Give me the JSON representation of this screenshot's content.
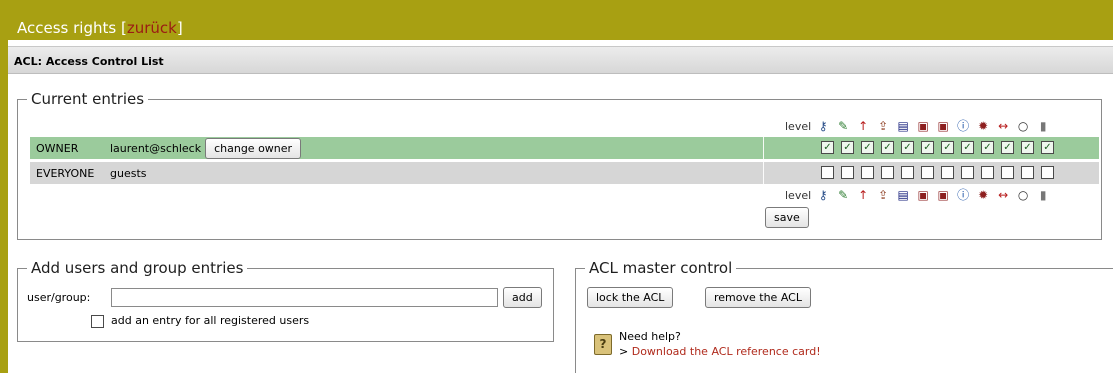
{
  "titlebar": {
    "title": "Access rights",
    "bracket_open": "[",
    "back_link": "zurück",
    "bracket_close": "]"
  },
  "acl_header": "ACL: Access Control List",
  "current_entries": {
    "legend": "Current entries",
    "level_label": "level",
    "permission_icons": [
      "key-icon",
      "pencil-icon",
      "arrow-up-icon",
      "upload-icon",
      "folder-icon",
      "folder-in-icon",
      "folder-out-icon",
      "info-icon",
      "gear-icon",
      "move-icon",
      "comment-icon",
      "trash-icon"
    ],
    "rows": [
      {
        "role": "OWNER",
        "user": "laurent@schleck",
        "button": "change owner",
        "permissions": [
          true,
          true,
          true,
          true,
          true,
          true,
          true,
          true,
          true,
          true,
          true,
          true
        ]
      },
      {
        "role": "EVERYONE",
        "user": "guests",
        "button": "",
        "permissions": [
          false,
          false,
          false,
          false,
          false,
          false,
          false,
          false,
          false,
          false,
          false,
          false
        ]
      }
    ],
    "save_label": "save"
  },
  "add_entries": {
    "legend": "Add users and group entries",
    "field_label": "user/group:",
    "field_value": "",
    "add_label": "add",
    "all_users_label": "add an entry for all registered users",
    "all_users_checked": false
  },
  "master_control": {
    "legend": "ACL master control",
    "lock_label": "lock the ACL",
    "remove_label": "remove the ACL",
    "help_title": "Need help?",
    "help_prefix": "> ",
    "help_link": "Download the ACL reference card!"
  },
  "colors": {
    "brand": "#a8a012",
    "owner_row": "#9bcb9c",
    "everyone_row": "#d6d6d6",
    "link": "#b02a1c"
  }
}
